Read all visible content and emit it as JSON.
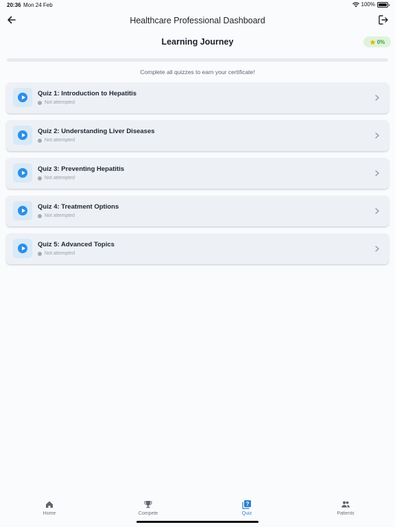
{
  "status_bar": {
    "time": "20:36",
    "date": "Mon 24 Feb",
    "battery": "100%"
  },
  "header": {
    "title": "Healthcare Professional Dashboard"
  },
  "journey": {
    "title": "Learning Journey",
    "progress_label": "0%",
    "progress_fraction": 0,
    "subtitle": "Complete all quizzes to earn your certificate!"
  },
  "quizzes": [
    {
      "title": "Quiz 1: Introduction to Hepatitis",
      "status": "Not attempted"
    },
    {
      "title": "Quiz 2: Understanding Liver Diseases",
      "status": "Not attempted"
    },
    {
      "title": "Quiz 3: Preventing Hepatitis",
      "status": "Not attempted"
    },
    {
      "title": "Quiz 4: Treatment Options",
      "status": "Not attempted"
    },
    {
      "title": "Quiz 5: Advanced Topics",
      "status": "Not attempted"
    }
  ],
  "tabs": [
    {
      "label": "Home",
      "icon": "home-icon",
      "active": false
    },
    {
      "label": "Compete",
      "icon": "trophy-icon",
      "active": false
    },
    {
      "label": "Quiz",
      "icon": "quiz-icon",
      "active": true
    },
    {
      "label": "Patients",
      "icon": "people-icon",
      "active": false
    }
  ],
  "colors": {
    "accent": "#2c8fe6",
    "card_background": "#edf0f5",
    "badge_background": "#dff3dc",
    "badge_text": "#3f9b47"
  }
}
